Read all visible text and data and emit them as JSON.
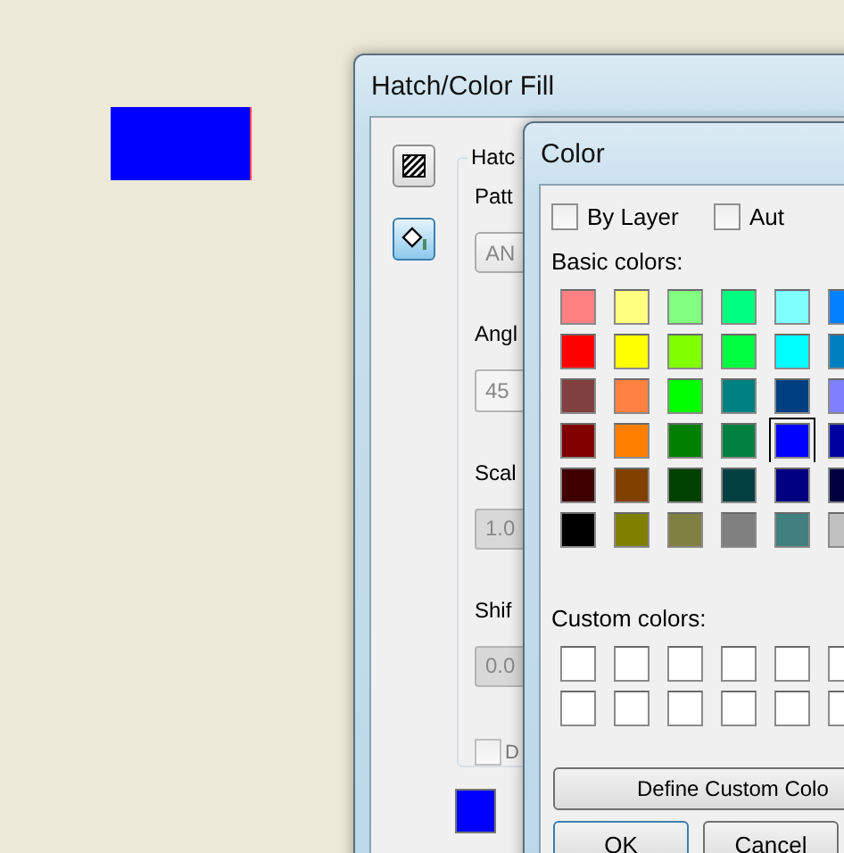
{
  "canvas_shape": {
    "color": "#0000ff"
  },
  "hatch_window": {
    "title": "Hatch/Color Fill",
    "mode_buttons": [
      {
        "kind": "hatch",
        "selected": false
      },
      {
        "kind": "fill",
        "selected": true
      }
    ],
    "group_label": "Hatc",
    "fields": [
      {
        "label": "Patt",
        "value": "AN",
        "kind": "combo",
        "disabled": false
      },
      {
        "label": "Angl",
        "value": "45",
        "kind": "text",
        "disabled": false
      },
      {
        "label": "Scal",
        "value": "1.0",
        "kind": "text",
        "disabled": true
      },
      {
        "label": "Shif",
        "value": "0.0",
        "kind": "text",
        "disabled": true
      }
    ],
    "checkbox": {
      "label": "D",
      "checked": false
    },
    "swatch": {
      "color": "#0000ff"
    }
  },
  "color_dialog": {
    "title": "Color",
    "options": [
      {
        "label": "By Layer",
        "checked": false
      },
      {
        "label": "Aut",
        "checked": false
      }
    ],
    "basic_label": "Basic colors:",
    "basic_colors": [
      [
        {
          "color": "#ff8080",
          "selected": false
        },
        {
          "color": "#ffff80",
          "selected": false
        },
        {
          "color": "#80ff80",
          "selected": false
        },
        {
          "color": "#00ff80",
          "selected": false
        },
        {
          "color": "#80ffff",
          "selected": false
        },
        {
          "color": "#0080ff",
          "selected": false
        }
      ],
      [
        {
          "color": "#ff0000",
          "selected": false
        },
        {
          "color": "#ffff00",
          "selected": false
        },
        {
          "color": "#80ff00",
          "selected": false
        },
        {
          "color": "#00ff40",
          "selected": false
        },
        {
          "color": "#00ffff",
          "selected": false
        },
        {
          "color": "#0080c0",
          "selected": false
        }
      ],
      [
        {
          "color": "#804040",
          "selected": false
        },
        {
          "color": "#ff8040",
          "selected": false
        },
        {
          "color": "#00ff00",
          "selected": false
        },
        {
          "color": "#008080",
          "selected": false
        },
        {
          "color": "#004080",
          "selected": false
        },
        {
          "color": "#8080ff",
          "selected": false
        }
      ],
      [
        {
          "color": "#800000",
          "selected": false
        },
        {
          "color": "#ff8000",
          "selected": false
        },
        {
          "color": "#008000",
          "selected": false
        },
        {
          "color": "#008040",
          "selected": false
        },
        {
          "color": "#0000ff",
          "selected": true
        },
        {
          "color": "#0000a0",
          "selected": false
        }
      ],
      [
        {
          "color": "#400000",
          "selected": false
        },
        {
          "color": "#804000",
          "selected": false
        },
        {
          "color": "#004000",
          "selected": false
        },
        {
          "color": "#004040",
          "selected": false
        },
        {
          "color": "#000080",
          "selected": false
        },
        {
          "color": "#000040",
          "selected": false
        }
      ],
      [
        {
          "color": "#000000",
          "selected": false
        },
        {
          "color": "#808000",
          "selected": false
        },
        {
          "color": "#808040",
          "selected": false
        },
        {
          "color": "#808080",
          "selected": false
        },
        {
          "color": "#408080",
          "selected": false
        },
        {
          "color": "#c0c0c0",
          "selected": false
        }
      ]
    ],
    "custom_label": "Custom colors:",
    "custom_colors": [
      [
        {
          "color": "#ffffff"
        },
        {
          "color": "#ffffff"
        },
        {
          "color": "#ffffff"
        },
        {
          "color": "#ffffff"
        },
        {
          "color": "#ffffff"
        },
        {
          "color": "#ffffff"
        }
      ],
      [
        {
          "color": "#ffffff"
        },
        {
          "color": "#ffffff"
        },
        {
          "color": "#ffffff"
        },
        {
          "color": "#ffffff"
        },
        {
          "color": "#ffffff"
        },
        {
          "color": "#ffffff"
        }
      ]
    ],
    "define_button": "Define Custom Colo",
    "buttons": [
      "OK",
      "Cancel"
    ]
  }
}
